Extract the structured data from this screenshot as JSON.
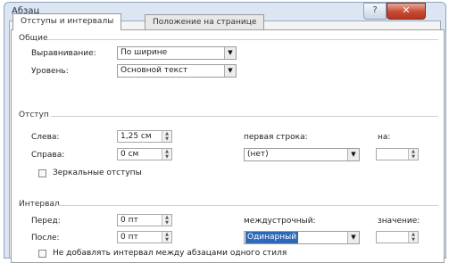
{
  "window": {
    "title": "Абзац",
    "help_label": "?",
    "close_label": "✕"
  },
  "tabs": [
    {
      "label": "Отступы и интервалы",
      "active": true
    },
    {
      "label": "Положение на странице",
      "active": false
    }
  ],
  "general": {
    "group_title": "Общие",
    "alignment_label": "Выравнивание:",
    "alignment_value": "По ширине",
    "level_label": "Уровень:",
    "level_value": "Основной текст"
  },
  "indent": {
    "group_title": "Отступ",
    "left_label": "Слева:",
    "left_value": "1,25 см",
    "right_label": "Справа:",
    "right_value": "0 см",
    "first_line_label": "первая строка:",
    "first_line_value": "(нет)",
    "by_label": "на:",
    "by_value": "",
    "mirror_label": "Зеркальные отступы",
    "mirror_checked": false
  },
  "spacing": {
    "group_title": "Интервал",
    "before_label": "Перед:",
    "before_value": "0 пт",
    "after_label": "После:",
    "after_value": "0 пт",
    "line_spacing_label": "междустрочный:",
    "line_spacing_value": "Одинарный",
    "value_label": "значение:",
    "value_value": "",
    "dont_add_label": "Не добавлять интервал между абзацами одного стиля",
    "dont_add_checked": false
  }
}
